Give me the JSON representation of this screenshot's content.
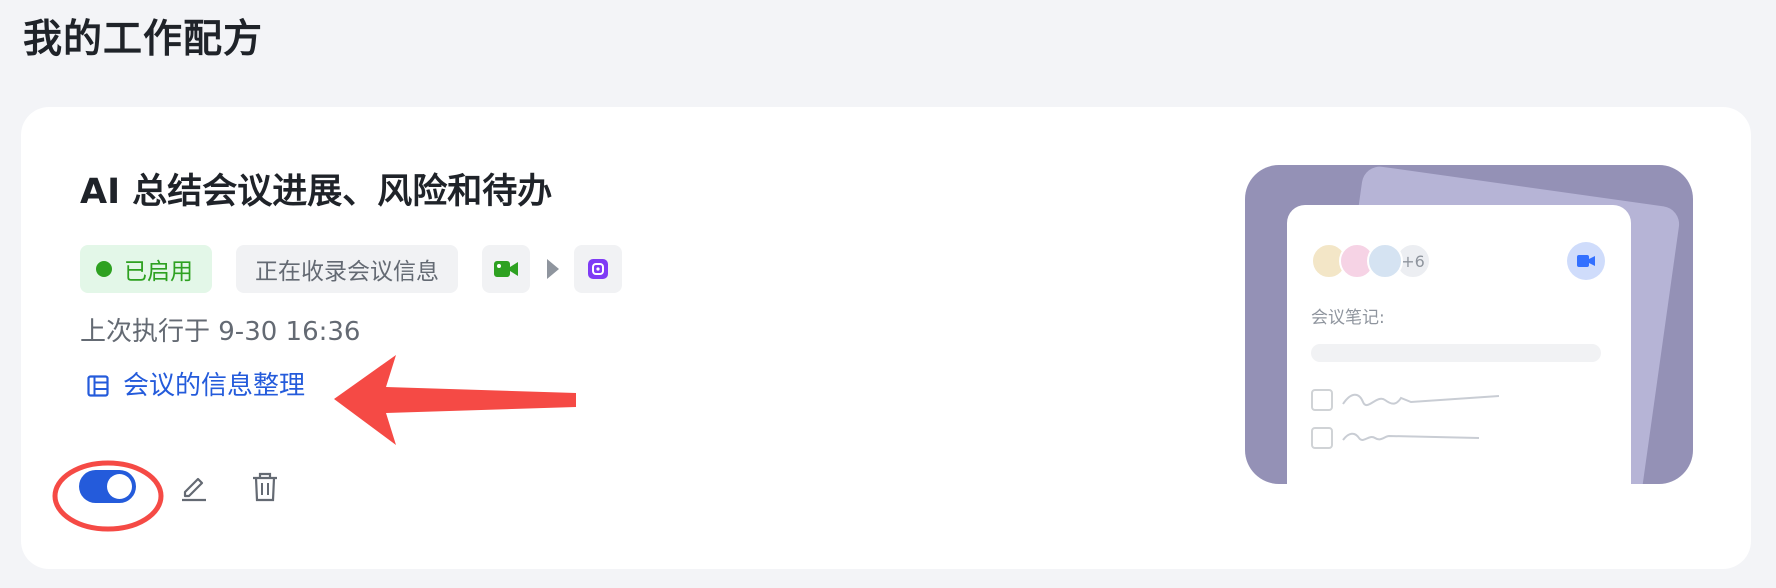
{
  "page": {
    "title": "我的工作配方"
  },
  "recipe": {
    "title": "AI 总结会议进展、风险和待办",
    "status_tag": "已启用",
    "trigger_tag": "正在收录会议信息",
    "last_run": "上次执行于 9-30 16:36",
    "output_doc": "会议的信息整理",
    "enabled": true,
    "flow_icons": [
      "video-meeting-icon",
      "play-arrow-icon",
      "ai-bot-icon"
    ]
  },
  "preview": {
    "participants_more": "+6",
    "notes_label": "会议笔记:"
  },
  "colors": {
    "accent": "#245bdb",
    "enabled_green": "#2ea121",
    "annotation_red": "#f54a45",
    "preview_bg": "#9491b6"
  }
}
